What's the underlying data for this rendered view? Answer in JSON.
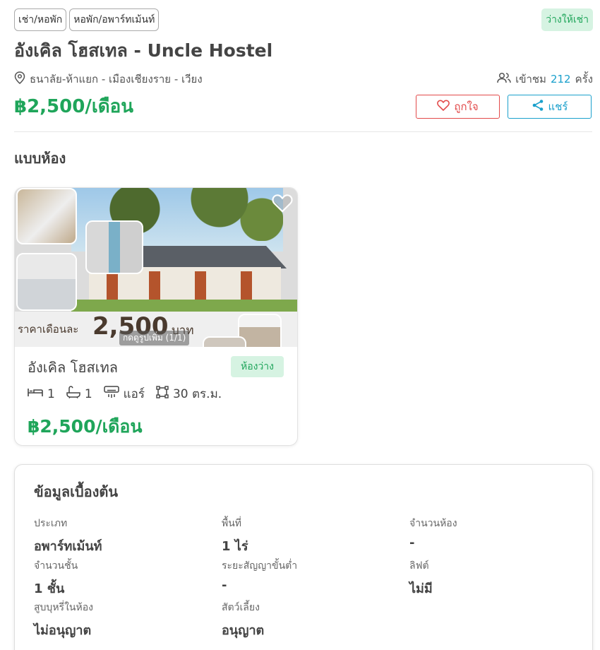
{
  "header": {
    "tags": [
      "เช่า/หอพัก",
      "หอพัก/อพาร์ทเม้นท์"
    ],
    "availability_badge": "ว่างให้เช่า",
    "title": "อังเคิล โฮสเทล - Uncle Hostel",
    "location": "ธนาลัย-ห้าแยก - เมืองเชียงราย - เวียง",
    "views_prefix": "เข้าชม",
    "views_count": "212",
    "views_suffix": "ครั้ง",
    "price": "฿2,500/เดือน",
    "like_label": "ถูกใจ",
    "share_label": "แชร์"
  },
  "room_types_section": {
    "title": "แบบห้อง",
    "rooms": [
      {
        "image_overlay": {
          "price_label": "ราคาเดือนละ",
          "price_value": "2,500",
          "price_unit": "บาท",
          "more_photos": "กดดูรูปเพิ่ม (1/1)"
        },
        "name": "อังเคิล โฮสเทล",
        "status": "ห้องว่าง",
        "beds": "1",
        "baths": "1",
        "aircon": "แอร์",
        "area": "30 ตร.ม.",
        "price": "฿2,500/เดือน"
      }
    ]
  },
  "basic_info": {
    "title": "ข้อมูลเบื้องต้น",
    "items": [
      {
        "label": "ประเภท",
        "value": "อพาร์ทเม้นท์"
      },
      {
        "label": "พื้นที่",
        "value": "1 ไร่"
      },
      {
        "label": "จำนวนห้อง",
        "value": "-"
      },
      {
        "label": "จำนวนชั้น",
        "value": "1 ชั้น"
      },
      {
        "label": "ระยะสัญญาขั้นต่ำ",
        "value": "-"
      },
      {
        "label": "ลิฟต์",
        "value": "ไม่มี"
      },
      {
        "label": "สูบบุหรี่ในห้อง",
        "value": "ไม่อนุญาต"
      },
      {
        "label": "สัตว์เลี้ยง",
        "value": "อนุญาต"
      }
    ]
  },
  "colors": {
    "accent_green": "#1fa55a",
    "accent_blue": "#1aa0cc",
    "like_red": "#e24a4a"
  }
}
